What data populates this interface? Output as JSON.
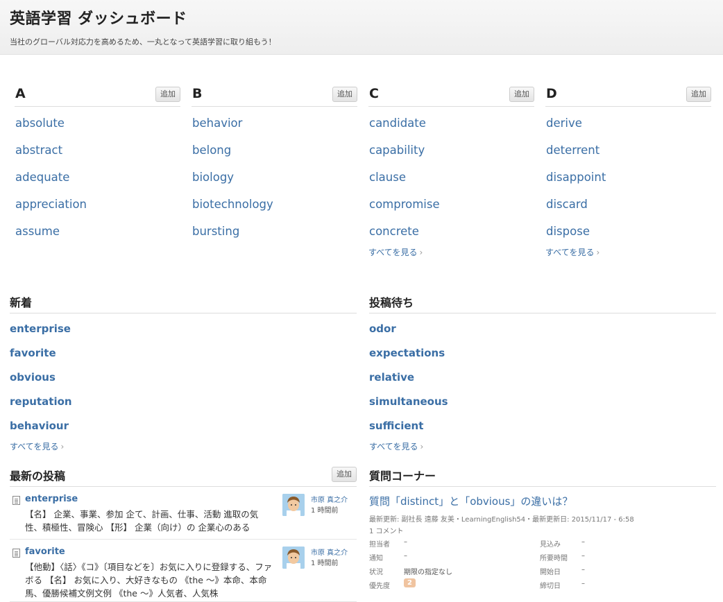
{
  "header": {
    "title": "英語学習 ダッシュボード",
    "subtitle": "当社のグローバル対応力を高めるため、一丸となって英語学習に取り組もう！"
  },
  "columns": [
    {
      "letter": "A",
      "add_label": "追加",
      "words": [
        "absolute",
        "abstract",
        "adequate",
        "appreciation",
        "assume"
      ],
      "see_all": ""
    },
    {
      "letter": "B",
      "add_label": "追加",
      "words": [
        "behavior",
        "belong",
        "biology",
        "biotechnology",
        "bursting"
      ],
      "see_all": ""
    },
    {
      "letter": "C",
      "add_label": "追加",
      "words": [
        "candidate",
        "capability",
        "clause",
        "compromise",
        "concrete"
      ],
      "see_all": "すべてを見る"
    },
    {
      "letter": "D",
      "add_label": "追加",
      "words": [
        "derive",
        "deterrent",
        "disappoint",
        "discard",
        "dispose"
      ],
      "see_all": "すべてを見る"
    }
  ],
  "new_section": {
    "title": "新着",
    "items": [
      "enterprise",
      "favorite",
      "obvious",
      "reputation",
      "behaviour"
    ],
    "see_all": "すべてを見る"
  },
  "pending_section": {
    "title": "投稿待ち",
    "items": [
      "odor",
      "expectations",
      "relative",
      "simultaneous",
      "sufficient"
    ],
    "see_all": "すべてを見る"
  },
  "latest_posts": {
    "title": "最新の投稿",
    "add_label": "追加",
    "posts": [
      {
        "title": "enterprise",
        "body": "【名】 企業、事業、参加 企て、計画、仕事、活動 進取の気性、積極性、冒険心 【形】 企業（向け）の 企業心のある",
        "author": "市原 真之介",
        "time": "1 時間前"
      },
      {
        "title": "favorite",
        "body": "【他動】〈話〉《コ》〔項目などを〕お気に入りに登録する、ファボる 【名】 お気に入り、大好きなもの 《the ～》本命、本命馬、優勝候補文例文例 《the ～》人気者、人気株",
        "author": "市原 真之介",
        "time": "1 時間前"
      }
    ]
  },
  "questions": {
    "title": "質問コーナー",
    "q_title": "質問「distinct」と「obvious」の違いは？",
    "meta": "最新更新: 副社長 遠藤 友美・LearningEnglish54・最新更新日: 2015/11/17 - 6:58",
    "comments": "1 コメント",
    "fields": {
      "assignee_label": "担当者",
      "assignee_value": "–",
      "notify_label": "通知",
      "notify_value": "–",
      "status_label": "状況",
      "status_value": "期限の指定なし",
      "priority_label": "優先度",
      "priority_value": "2",
      "estimate_label": "見込み",
      "estimate_value": "–",
      "duration_label": "所要時間",
      "duration_value": "–",
      "start_label": "開始日",
      "start_value": "–",
      "due_label": "締切日",
      "due_value": "–"
    }
  },
  "colors": {
    "link": "#3a6ea5",
    "badge": "#f0c4a0"
  }
}
